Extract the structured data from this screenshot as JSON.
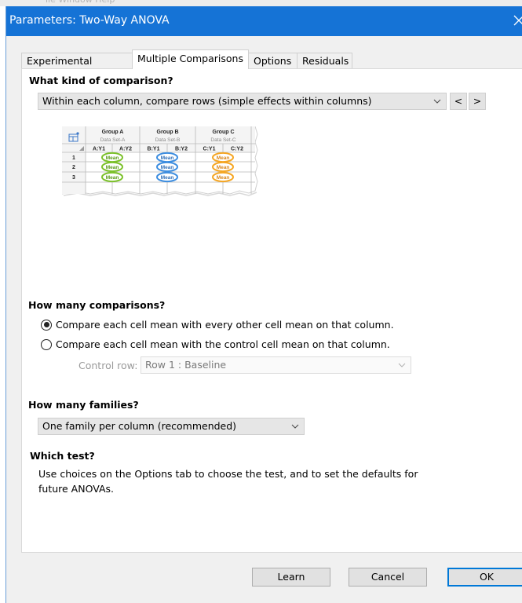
{
  "window": {
    "title": "Parameters: Two-Way ANOVA"
  },
  "tabs": [
    {
      "label": "Experimental Design",
      "active": false
    },
    {
      "label": "Multiple Comparisons",
      "active": true
    },
    {
      "label": "Options",
      "active": false
    },
    {
      "label": "Residuals",
      "active": false
    }
  ],
  "comparison_kind": {
    "heading": "What kind of comparison?",
    "selected": "Within each column, compare rows (simple effects within columns)",
    "prev_label": "<",
    "next_label": ">"
  },
  "diagram": {
    "groups": [
      {
        "name": "Group A",
        "dataset": "Data Set-A",
        "cols": [
          "A:Y1",
          "A:Y2"
        ],
        "color": "#7cc12a"
      },
      {
        "name": "Group B",
        "dataset": "Data Set-B",
        "cols": [
          "B:Y1",
          "B:Y2"
        ],
        "color": "#3c8de0"
      },
      {
        "name": "Group C",
        "dataset": "Data Set-C",
        "cols": [
          "C:Y1",
          "C:Y2"
        ],
        "color": "#f5a623"
      }
    ],
    "rows": [
      "1",
      "2",
      "3"
    ],
    "mean_label": "Mean"
  },
  "how_many": {
    "heading": "How many comparisons?",
    "option_all": "Compare each cell mean with every other cell mean on that column.",
    "option_control": "Compare each cell mean with the control cell mean on that column.",
    "selected": "all",
    "control_label": "Control row:",
    "control_value": "Row 1 : Baseline"
  },
  "families": {
    "heading": "How many families?",
    "selected": "One family per column (recommended)"
  },
  "which_test": {
    "heading": "Which test?",
    "text_line1": "Use choices on the Options tab to choose the test, and to set the defaults for",
    "text_line2": "future ANOVAs."
  },
  "footer": {
    "learn": "Learn",
    "cancel": "Cancel",
    "ok": "OK"
  }
}
